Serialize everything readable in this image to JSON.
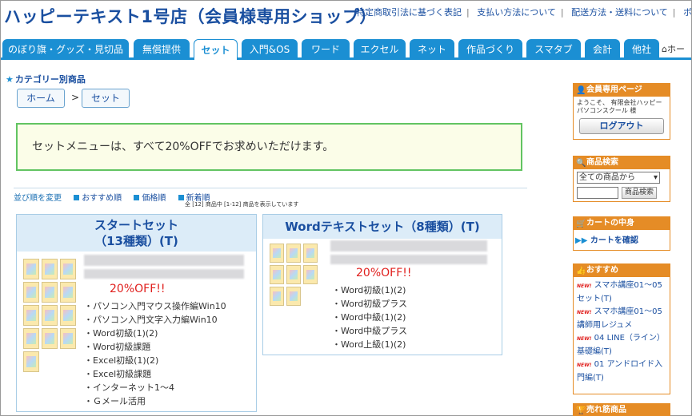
{
  "header": {
    "shop_title": "ハッピーテキスト1号店（会員様専用ショップ）",
    "links": [
      "特定商取引法に基づく表記",
      "支払い方法について",
      "配送方法・送料について",
      "ボ"
    ]
  },
  "nav": {
    "tabs": [
      "のぼり旗・グッズ・見切品",
      "無償提供",
      "セット",
      "入門&OS",
      "ワード",
      "エクセル",
      "ネット",
      "作品づくり",
      "スマタブ",
      "会計",
      "他社"
    ],
    "active_index": 2,
    "home": "ホー"
  },
  "category_heading": "カテゴリー別商品",
  "breadcrumb": {
    "home": "ホーム",
    "sep": ">",
    "current": "セット"
  },
  "notice": "セットメニューは、すべて20%OFFでお求めいただけます。",
  "sort": {
    "label": "並び順を変更",
    "options": [
      "おすすめ順",
      "価格順",
      "新着順"
    ],
    "count": "全 [12] 商品中 [1-12] 商品を表示しています"
  },
  "products": [
    {
      "title_line1": "スタートセット",
      "title_line2": "（13種類）(T)",
      "discount": "20%OFF!!",
      "items": [
        "パソコン入門マウス操作編Win10",
        "パソコン入門文字入力編Win10",
        "Word初級(1)(2)",
        "Word初級課題",
        "Excel初級(1)(2)",
        "Excel初級課題",
        "インターネット1～4",
        "Ｇメール活用"
      ]
    },
    {
      "title_line1": "Wordテキストセット（8種類）(T)",
      "discount": "20%OFF!!",
      "items": [
        "Word初級(1)(2)",
        "Word初級プラス",
        "Word中級(1)(2)",
        "Word中級プラス",
        "Word上級(1)(2)"
      ]
    }
  ],
  "sidebar": {
    "member": {
      "title": "会員専用ページ",
      "welcome": "ようこそ、 有限会社ハッピーパソコンスクール 様",
      "logout": "ログアウト"
    },
    "search": {
      "title": "商品検索",
      "select_value": "全ての商品から",
      "button": "商品検索"
    },
    "cart": {
      "title": "カートの中身",
      "link": "カートを確認"
    },
    "recommend": {
      "title": "おすすめ",
      "new_badge": "NEW!",
      "items": [
        "スマホ講座01～05セット(T)",
        "スマホ講座01～05 講師用レジュメ",
        "04 LINE（ライン）基礎編(T)",
        "01 アンドロイド入門編(T)"
      ]
    },
    "bestseller": {
      "title": "売れ筋商品"
    }
  },
  "colors": {
    "accent": "#1b8fd3",
    "title": "#1a4fa0",
    "side": "#e58c26",
    "off": "#e0201e",
    "notice_border": "#62c462"
  }
}
